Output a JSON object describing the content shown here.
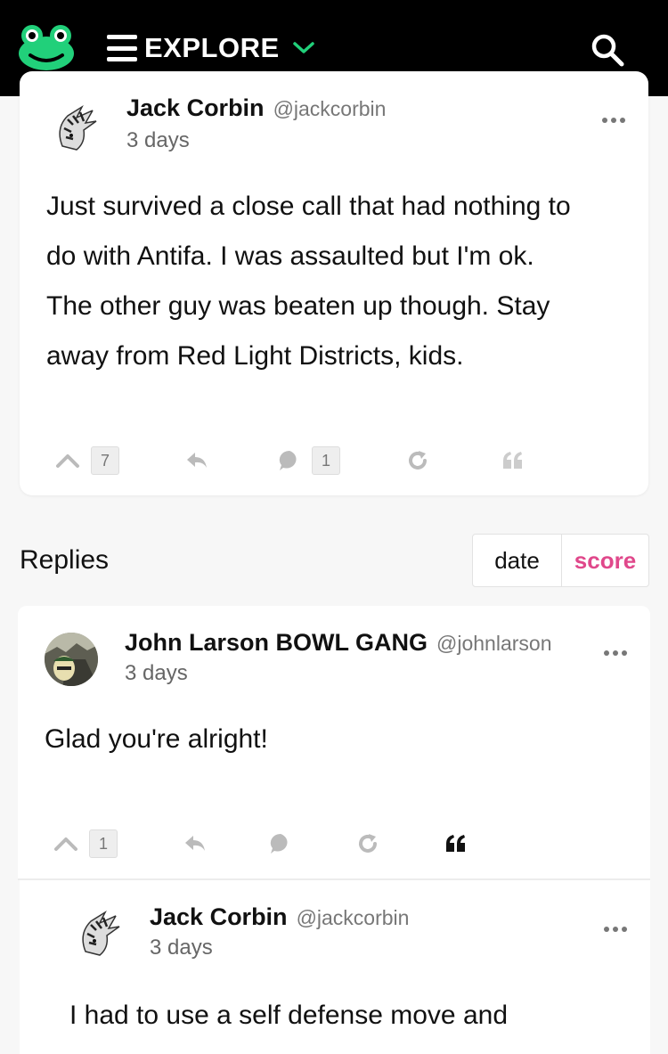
{
  "nav": {
    "menu_label": "EXPLORE"
  },
  "post": {
    "author_name": "Jack Corbin",
    "author_handle": "@jackcorbin",
    "time": "3 days",
    "lines": [
      "Just survived a close call that had nothing to",
      "do with Antifa. I was assaulted but I'm ok.",
      "The other guy was beaten up though. Stay",
      "away from Red Light Districts, kids."
    ],
    "upvotes": "7",
    "comments": "1"
  },
  "replies": {
    "title": "Replies",
    "sort_date": "date",
    "sort_score": "score",
    "items": [
      {
        "author_name": "John Larson BOWL GANG",
        "author_handle": "@johnlarson",
        "time": "3 days",
        "text": "Glad you're alright!",
        "upvotes": "1"
      },
      {
        "author_name": "Jack Corbin",
        "author_handle": "@jackcorbin",
        "time": "3 days",
        "text": "I had to use a self defense move and"
      }
    ]
  },
  "colors": {
    "topbar": "#000000",
    "brand_green": "#21d07a",
    "accent_pink": "#e0488b"
  },
  "icons": [
    "frog-logo-icon",
    "hamburger-icon",
    "chevron-down-icon",
    "search-icon",
    "more-options-icon",
    "upvote-icon",
    "reply-icon",
    "comment-icon",
    "repost-icon",
    "quote-icon"
  ]
}
